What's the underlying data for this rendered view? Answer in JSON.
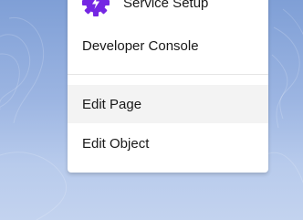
{
  "menu": {
    "items": [
      {
        "label": "Service Setup",
        "icon": "service-setup-gear-bolt-icon"
      },
      {
        "label": "Developer Console"
      },
      {
        "label": "Edit Page",
        "state": "hovered"
      },
      {
        "label": "Edit Object"
      }
    ]
  },
  "colors": {
    "background_top": "#7f9fd6",
    "background_bottom": "#c3d3ef",
    "icon_purple": "#7526e3",
    "hover_row": "#f3f3f3",
    "text": "#181818"
  }
}
